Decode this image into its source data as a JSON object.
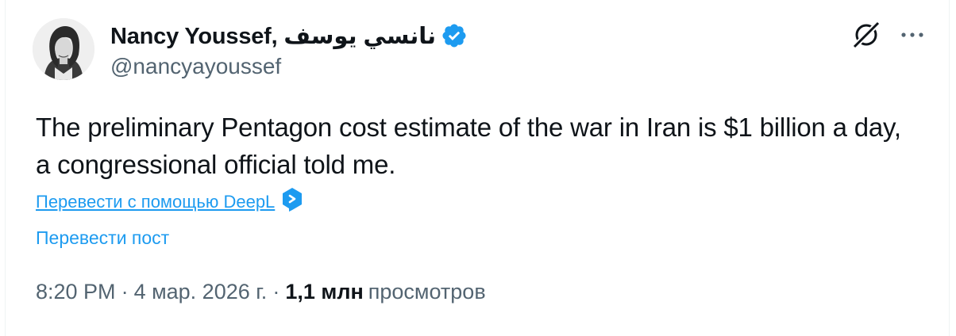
{
  "author": {
    "display_name": "Nancy Youssef, نانسي يوسف",
    "handle": "@nancyayoussef",
    "verified_icon": "verified-badge-icon"
  },
  "tweet": {
    "text": "The preliminary Pentagon cost estimate of the war in Iran is $1 billion a day, a congressional official told me."
  },
  "actions": {
    "deepl_label": "Перевести с помощью DeepL",
    "translate_post_label": "Перевести пост"
  },
  "meta": {
    "time": "8:20 PM",
    "separator": "·",
    "date": "4 мар. 2026 г.",
    "views_count": "1,1 млн",
    "views_label": "просмотров"
  },
  "colors": {
    "accent": "#1d9bf0",
    "secondary_text": "#536471",
    "primary_text": "#0f1419"
  }
}
